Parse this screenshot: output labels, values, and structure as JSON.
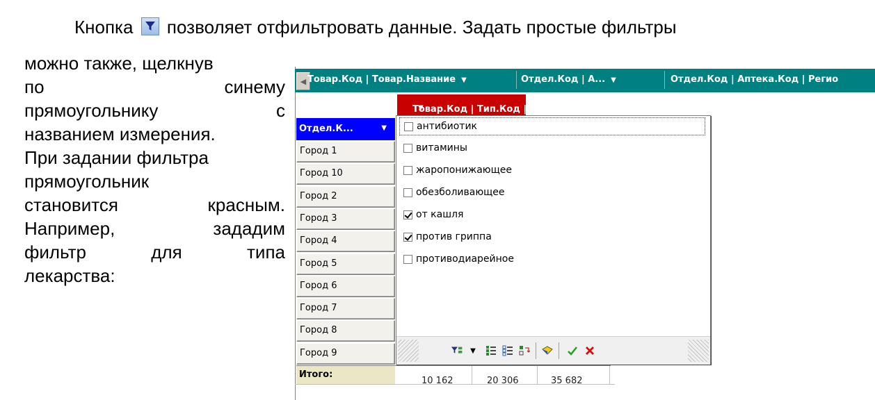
{
  "paragraph": {
    "line1_before": "Кнопка",
    "line1_after": "позволяет отфильтровать данные. Задать простые фильтры",
    "filter_icon": "filter-icon",
    "left_lines": [
      [
        "можно также, щелкнув"
      ],
      [
        "по",
        "синему"
      ],
      [
        "прямоугольнику",
        "с"
      ],
      [
        "названием измерения."
      ],
      [
        "При задании фильтра"
      ],
      [
        "прямоугольник"
      ],
      [
        "становится",
        "красным."
      ],
      [
        "Например,",
        "зададим"
      ],
      [
        "фильтр",
        "для",
        "типа"
      ],
      [
        "лекарства:"
      ]
    ]
  },
  "screenshot": {
    "column_dimensions": [
      "Товар.Код | Товар.Название",
      "Отдел.Код | А...",
      "Отдел.Код | Аптека.Код | Регио"
    ],
    "filtered_dimension": "Товар.Код | Тип.Код | Тип.Назван...",
    "row_dimension": "Отдел.К...",
    "rows": [
      "Город 1",
      "Город 10",
      "Город 2",
      "Город 3",
      "Город 4",
      "Город 5",
      "Город 6",
      "Город 7",
      "Город 8",
      "Город 9"
    ],
    "total_label": "Итого:",
    "total_values": [
      "10 162",
      "20 306",
      "35 682"
    ],
    "filter_items": [
      {
        "label": "антибиотик",
        "checked": false
      },
      {
        "label": "витамины",
        "checked": false
      },
      {
        "label": "жаропонижающее",
        "checked": false
      },
      {
        "label": "обезболивающее",
        "checked": false
      },
      {
        "label": "от кашля",
        "checked": true
      },
      {
        "label": "против гриппа",
        "checked": true
      },
      {
        "label": "противодиарейное",
        "checked": false
      }
    ],
    "toolbar_icons": [
      "filter-dropdown-icon",
      "select-all-icon",
      "clear-all-icon",
      "invert-selection-icon",
      "eraser-icon",
      "ok-check-icon",
      "cancel-x-icon"
    ],
    "colors": {
      "column_header_bg": "#008080",
      "filtered_header_bg": "#c80000",
      "row_header_bg": "#0000ff",
      "total_bg": "#ebe6c6"
    }
  }
}
